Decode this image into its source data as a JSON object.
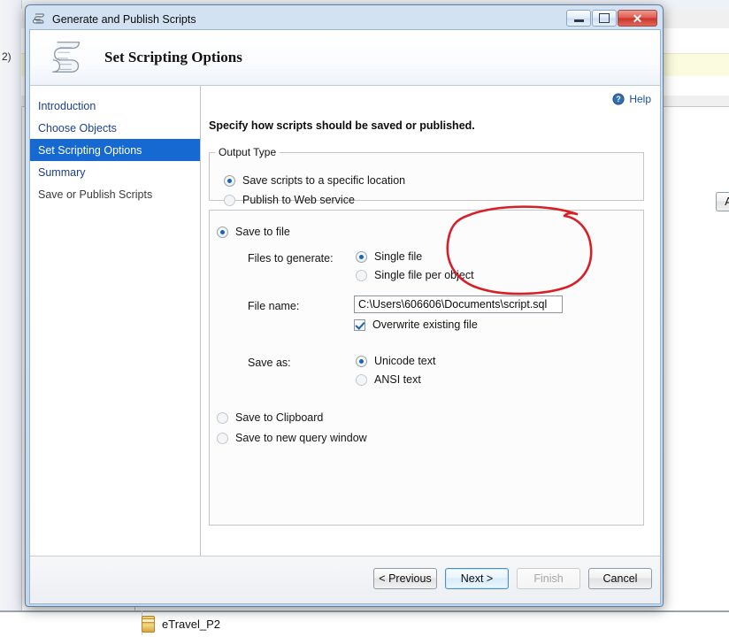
{
  "background": {
    "db_item_label": "eTravel_P2",
    "db_icon": "database-icon",
    "left_fragment_text": "2)"
  },
  "window": {
    "title": "Generate and Publish Scripts",
    "icon": "script-scroll-icon",
    "minimize_label": "Minimize",
    "maximize_label": "Maximize",
    "close_label": "Close"
  },
  "banner": {
    "title": "Set Scripting Options",
    "icon": "script-scroll-icon"
  },
  "sidebar": {
    "items": [
      {
        "label": "Introduction",
        "state": "done"
      },
      {
        "label": "Choose Objects",
        "state": "done"
      },
      {
        "label": "Set Scripting Options",
        "state": "active"
      },
      {
        "label": "Summary",
        "state": "done"
      },
      {
        "label": "Save or Publish Scripts",
        "state": "future"
      }
    ]
  },
  "pane": {
    "help_label": "Help",
    "help_icon": "help-question-icon",
    "instruction": "Specify how scripts should be saved or published."
  },
  "output_type": {
    "legend": "Output Type",
    "options": [
      {
        "label": "Save scripts to a specific location",
        "checked": true
      },
      {
        "label": "Publish to Web service",
        "checked": false
      }
    ]
  },
  "save_section": {
    "save_to_file": {
      "label": "Save to file",
      "checked": true
    },
    "advanced_button": "Advanced",
    "files_to_generate_label": "Files to generate:",
    "files_to_generate_options": [
      {
        "label": "Single file",
        "checked": true
      },
      {
        "label": "Single file per object",
        "checked": false
      }
    ],
    "file_name_label": "File name:",
    "file_name_value": "C:\\Users\\606606\\Documents\\script.sql",
    "browse_button": "...",
    "overwrite_label": "Overwrite existing file",
    "overwrite_checked": true,
    "save_as_label": "Save as:",
    "save_as_options": [
      {
        "label": "Unicode text",
        "checked": true
      },
      {
        "label": "ANSI text",
        "checked": false
      }
    ],
    "save_to_clipboard": {
      "label": "Save to Clipboard",
      "checked": false
    },
    "save_to_new_query_window": {
      "label": "Save to new query window",
      "checked": false
    }
  },
  "footer": {
    "previous": "< Previous",
    "next": "Next >",
    "finish": "Finish",
    "cancel": "Cancel"
  },
  "annotation": {
    "shape": "hand-drawn-ellipse",
    "color": "#d61f26",
    "targets": "Advanced button"
  },
  "colors": {
    "selection_blue": "#1669d0",
    "link_blue": "#1b3f8f",
    "annotation_red": "#d61f26",
    "highlight_row": "#fbfbdf"
  }
}
